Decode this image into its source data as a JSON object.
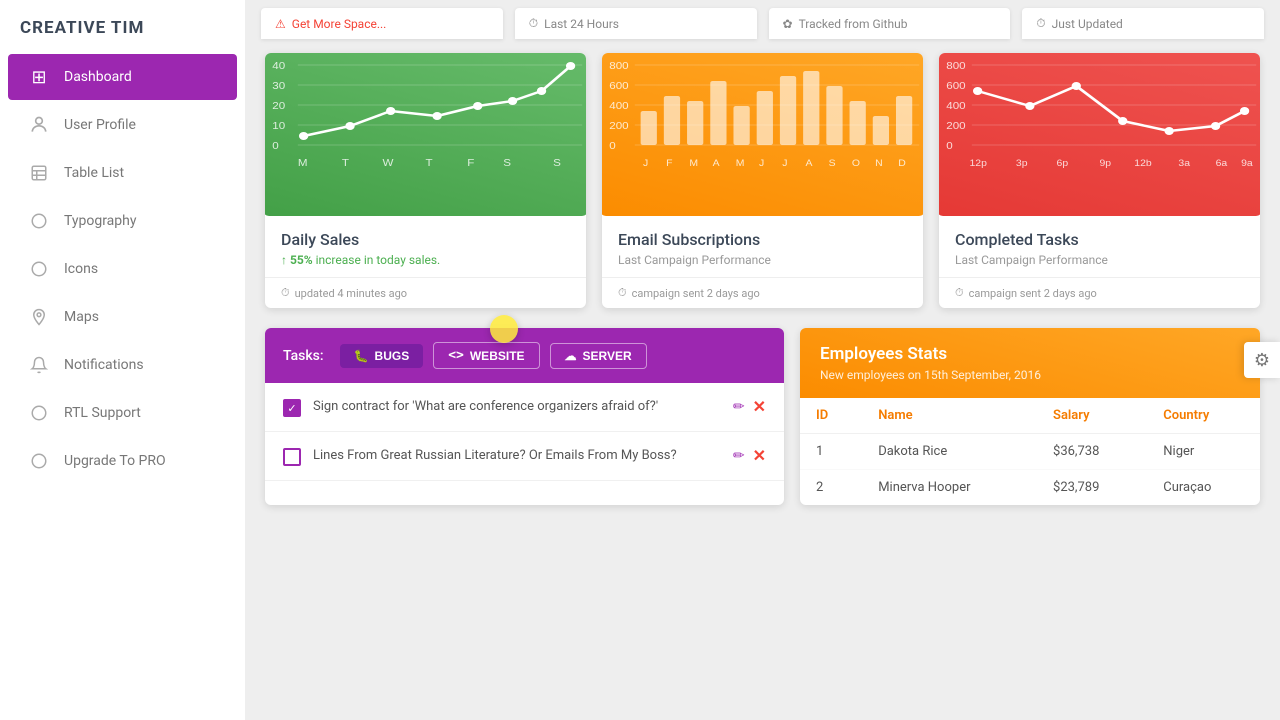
{
  "brand": "CREATIVE TIM",
  "sidebar": {
    "items": [
      {
        "id": "dashboard",
        "label": "Dashboard",
        "icon": "⊞",
        "active": true
      },
      {
        "id": "user-profile",
        "label": "User Profile",
        "icon": "○",
        "active": false
      },
      {
        "id": "table-list",
        "label": "Table List",
        "icon": "□",
        "active": false
      },
      {
        "id": "typography",
        "label": "Typography",
        "icon": "○",
        "active": false
      },
      {
        "id": "icons",
        "label": "Icons",
        "icon": "○",
        "active": false
      },
      {
        "id": "maps",
        "label": "Maps",
        "icon": "◎",
        "active": false
      },
      {
        "id": "notifications",
        "label": "Notifications",
        "icon": "◎",
        "active": false
      },
      {
        "id": "rtl-support",
        "label": "RTL Support",
        "icon": "◎",
        "active": false
      },
      {
        "id": "upgrade",
        "label": "Upgrade To PRO",
        "icon": "○",
        "active": false
      }
    ]
  },
  "cards": [
    {
      "id": "daily-sales",
      "color": "green",
      "title": "Daily Sales",
      "stat": "55% increase in today sales.",
      "stat_arrow": "↑",
      "footer": "updated 4 minutes ago",
      "footer_icon": "⏱"
    },
    {
      "id": "email-subscriptions",
      "color": "orange",
      "title": "Email Subscriptions",
      "subtitle": "Last Campaign Performance",
      "footer": "campaign sent 2 days ago",
      "footer_icon": "⏱"
    },
    {
      "id": "completed-tasks",
      "color": "red",
      "title": "Completed Tasks",
      "subtitle": "Last Campaign Performance",
      "footer": "campaign sent 2 days ago",
      "footer_icon": "⏱"
    }
  ],
  "tasks": {
    "label": "Tasks:",
    "buttons": [
      {
        "id": "bugs",
        "label": "BUGS",
        "icon": "🐛"
      },
      {
        "id": "website",
        "label": "WEBSITE",
        "icon": "<>"
      },
      {
        "id": "server",
        "label": "SERVER",
        "icon": "☁"
      }
    ],
    "items": [
      {
        "id": 1,
        "text": "Sign contract for 'What are conference organizers afraid of?'",
        "checked": true
      },
      {
        "id": 2,
        "text": "Lines From Great Russian Literature? Or Emails From My Boss?",
        "checked": false
      }
    ]
  },
  "employees": {
    "title": "Employees Stats",
    "subtitle": "New employees on 15th September, 2016",
    "columns": [
      "ID",
      "Name",
      "Salary",
      "Country"
    ],
    "rows": [
      {
        "id": 1,
        "name": "Dakota Rice",
        "salary": "$36,738",
        "country": "Niger"
      },
      {
        "id": 2,
        "name": "Minerva Hooper",
        "salary": "$23,789",
        "country": "Curaçao"
      }
    ]
  },
  "settings_icon": "⚙"
}
